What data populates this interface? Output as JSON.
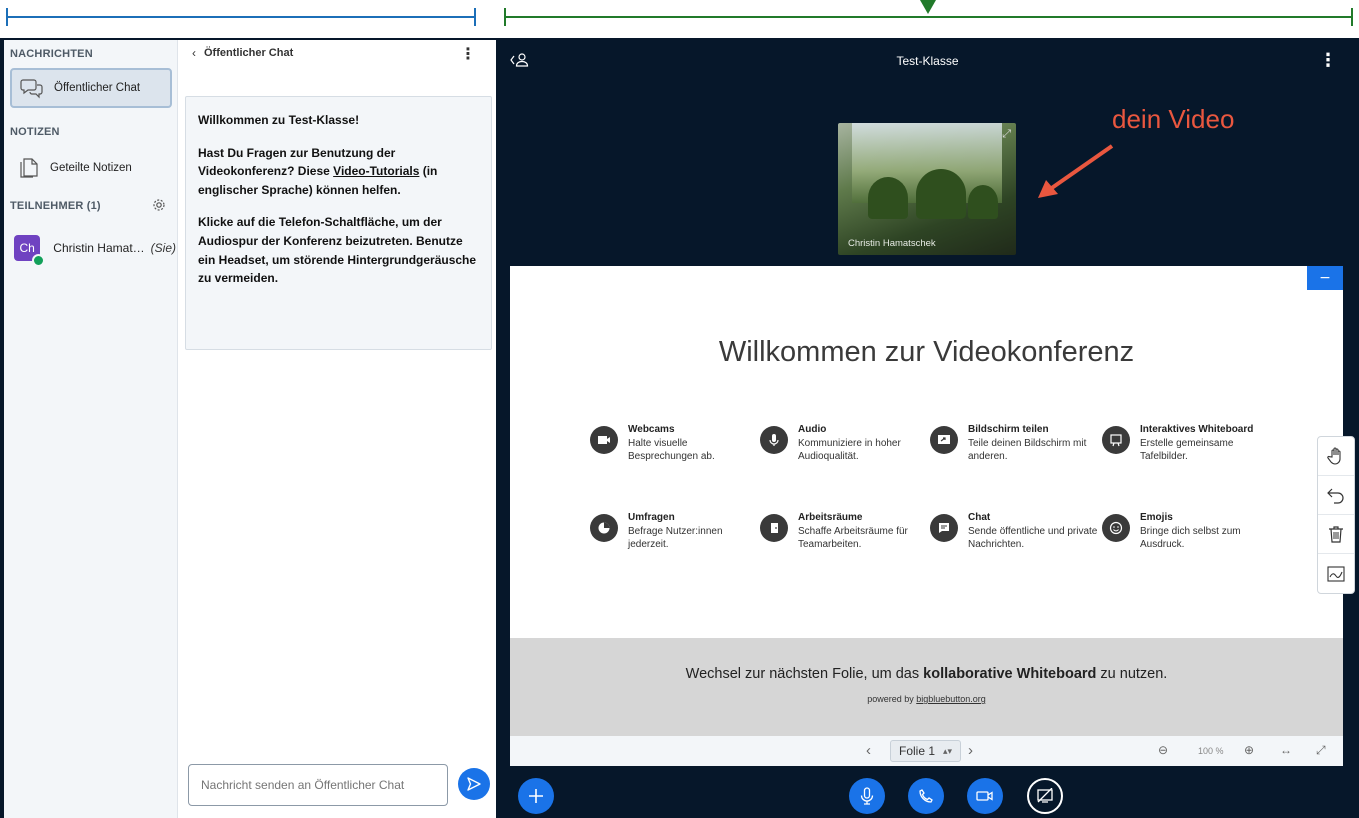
{
  "sidebar": {
    "messages_title": "NACHRICHTEN",
    "public_chat_label": "Öffentlicher Chat",
    "notes_title": "NOTIZEN",
    "shared_notes_label": "Geteilte Notizen",
    "participants_title": "TEILNEHMER (1)",
    "user": {
      "initials": "Ch",
      "name": "Christin Hamat…",
      "you_tag": "(Sie)"
    }
  },
  "chat": {
    "header_title": "Öffentlicher Chat",
    "welcome_prefix": "Willkommen zu ",
    "welcome_room": "Test-Klasse",
    "welcome_suffix": "!",
    "help_prefix": "Hast Du Fragen zur Benutzung der Videokonferenz? Diese ",
    "help_link": "Video-Tutorials",
    "help_suffix": " (in englischer Sprache) können helfen.",
    "audio_hint": "Klicke auf die Telefon-Schaltfläche, um der Audiospur der Konferenz beizutreten. Benutze ein Headset, um störende Hintergrundgeräusche zu vermeiden.",
    "input_placeholder": "Nachricht senden an Öffentlicher Chat"
  },
  "main": {
    "meeting_title": "Test-Klasse",
    "video_name": "Christin Hamatschek",
    "annotation": "dein Video",
    "annotation_color": "#e9573f"
  },
  "slide": {
    "title": "Willkommen zur Videokonferenz",
    "features": [
      {
        "title": "Webcams",
        "desc": "Halte visuelle Besprechungen ab.",
        "icon": "camera-icon"
      },
      {
        "title": "Audio",
        "desc": "Kommuniziere in hoher Audioqualität.",
        "icon": "microphone-icon"
      },
      {
        "title": "Bildschirm teilen",
        "desc": "Teile deinen Bildschirm mit anderen.",
        "icon": "screen-share-icon"
      },
      {
        "title": "Interaktives Whiteboard",
        "desc": "Erstelle gemeinsame Tafelbilder.",
        "icon": "whiteboard-icon"
      },
      {
        "title": "Umfragen",
        "desc": "Befrage Nutzer:innen jederzeit.",
        "icon": "pie-chart-icon"
      },
      {
        "title": "Arbeitsräume",
        "desc": "Schaffe Arbeitsräume für Teamarbeiten.",
        "icon": "door-icon"
      },
      {
        "title": "Chat",
        "desc": "Sende öffentliche und private Nachrichten.",
        "icon": "chat-icon"
      },
      {
        "title": "Emojis",
        "desc": "Bringe dich selbst zum Ausdruck.",
        "icon": "smiley-icon"
      }
    ],
    "footer_prefix": "Wechsel zur nächsten Folie, um das ",
    "footer_bold": "kollaborative Whiteboard",
    "footer_suffix": " zu nutzen.",
    "powered_prefix": "powered by ",
    "powered_link": "bigbluebutton.org"
  },
  "controls": {
    "slide_label": "Folie 1",
    "zoom": "100 %"
  },
  "colors": {
    "primary": "#1a73e8",
    "app_background": "#06172a",
    "ruler_blue": "#1c6fb8",
    "ruler_green": "#217a2a"
  }
}
